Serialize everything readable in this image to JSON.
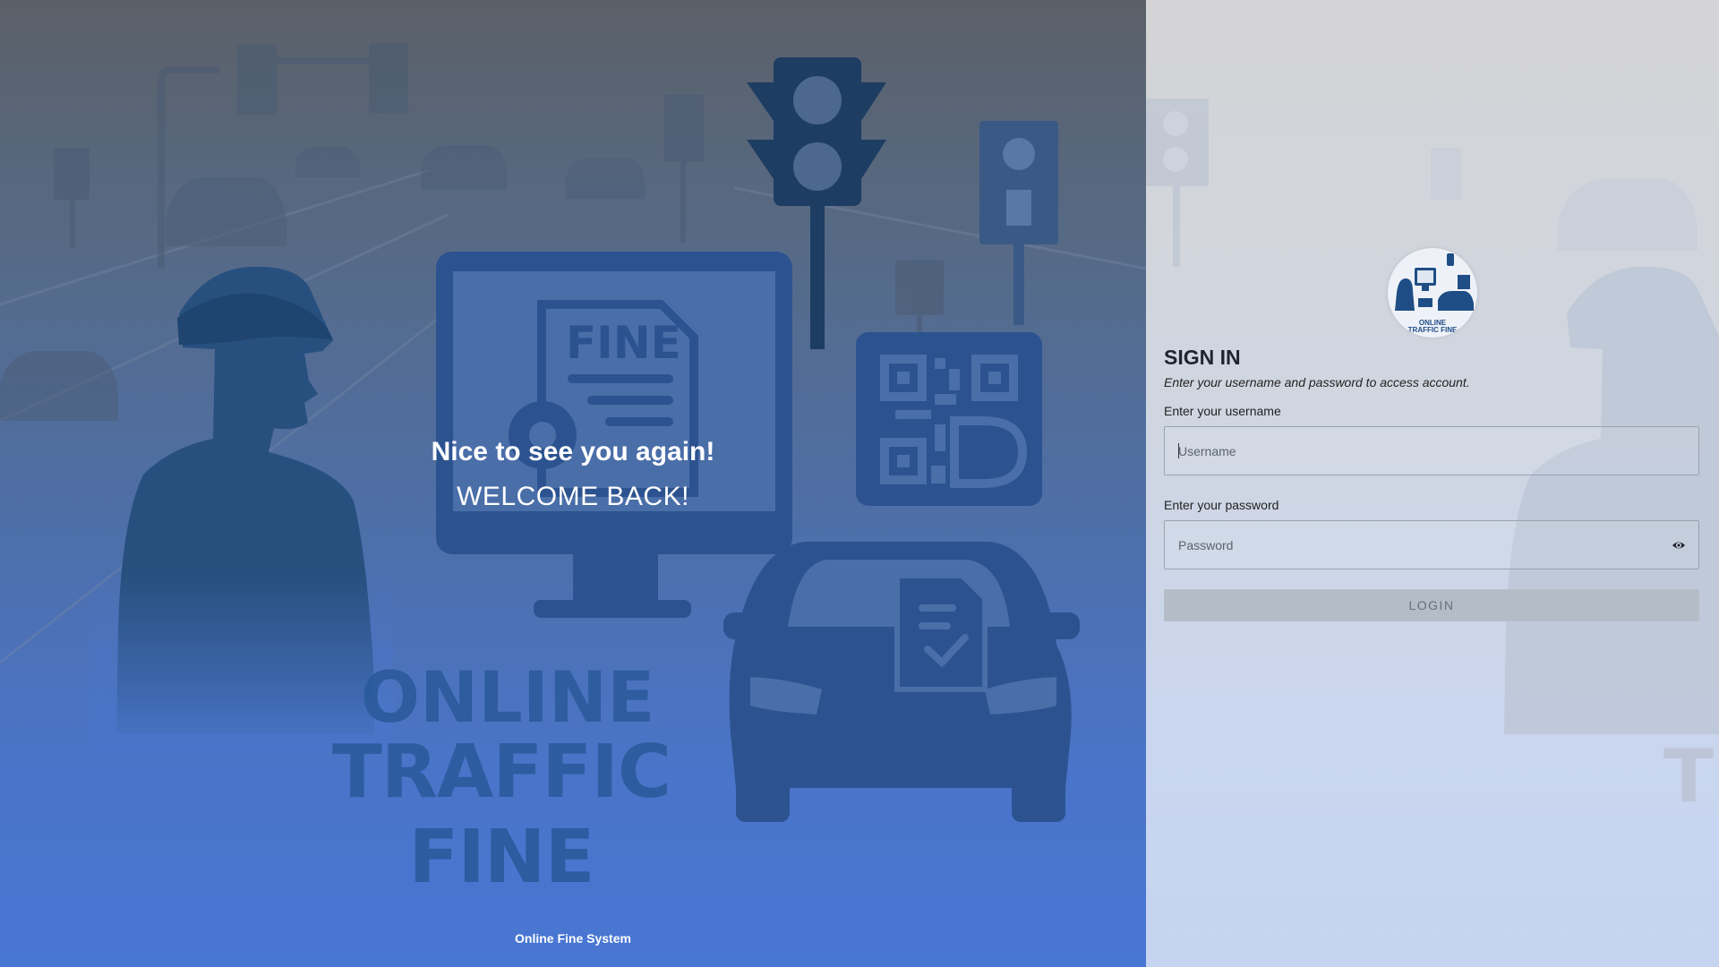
{
  "hero": {
    "greeting": "Nice to see you again!",
    "welcome": "WELCOME BACK!",
    "fine_label": "FINE",
    "brand_line1": "ONLINE",
    "brand_line2": "TRAFFIC FINE",
    "footer": "Online Fine System"
  },
  "logo": {
    "line1": "ONLINE",
    "line2": "TRAFFIC FINE"
  },
  "signin": {
    "title": "SIGN IN",
    "subtitle": "Enter your username and password to access account.",
    "username_label": "Enter your username",
    "username_placeholder": "Username",
    "username_value": "",
    "password_label": "Enter your password",
    "password_placeholder": "Password",
    "password_value": "",
    "login_label": "LOGIN",
    "password_toggle_icon": "eye-icon"
  },
  "panel": {
    "ghost_text": "TI"
  },
  "colors": {
    "hero_top": "#5b6068",
    "hero_bottom": "#4876d3",
    "illustration": "#2b5a9c",
    "panel_top": "#d4d4d6",
    "panel_bottom": "#c6d4f2",
    "button_disabled": "#b4bcc8"
  }
}
